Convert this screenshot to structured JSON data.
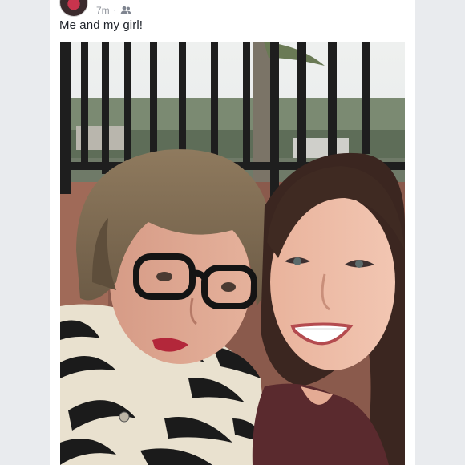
{
  "post": {
    "timestamp": "7m",
    "separator": "·",
    "audience_icon": "friends-icon",
    "caption": "Me and my girl!"
  },
  "colors": {
    "page_background": "#e9ebee",
    "card_background": "#ffffff",
    "meta_text": "#90949c",
    "caption_text": "#1d2129"
  }
}
